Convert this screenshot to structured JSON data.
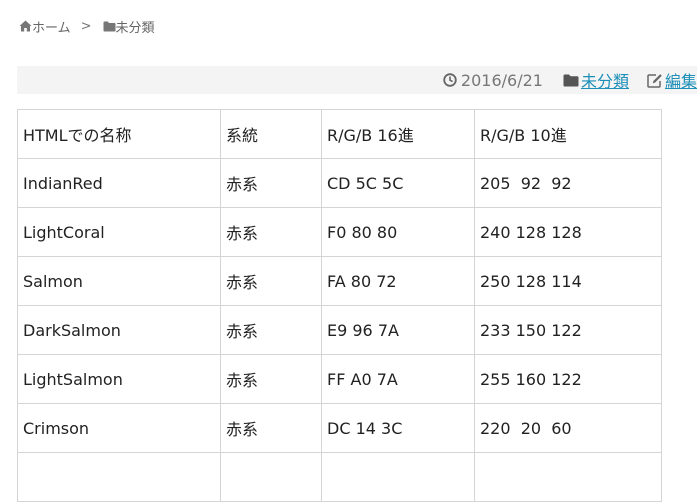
{
  "breadcrumb": {
    "home": "ホーム",
    "separator": ">",
    "category": "未分類"
  },
  "meta": {
    "date": "2016/6/21",
    "category": "未分類",
    "edit": "編集"
  },
  "table": {
    "headers": [
      "HTMLでの名称",
      "系統",
      "R/G/B 16進",
      "R/G/B 10進"
    ],
    "rows": [
      [
        "IndianRed",
        "赤系",
        "CD 5C 5C",
        "205  92  92"
      ],
      [
        "LightCoral",
        "赤系",
        "F0 80 80",
        "240 128 128"
      ],
      [
        "Salmon",
        "赤系",
        "FA 80 72",
        "250 128 114"
      ],
      [
        "DarkSalmon",
        "赤系",
        "E9 96 7A",
        "233 150 122"
      ],
      [
        "LightSalmon",
        "赤系",
        "FF A0 7A",
        "255 160 122"
      ],
      [
        "Crimson",
        "赤系",
        "DC 14 3C",
        "220  20  60"
      ]
    ]
  },
  "colors": {
    "link": "#1d8fb8",
    "meta_bar_bg": "#f4f4f4",
    "table_border": "#d5d5d5"
  },
  "icons": [
    "home-icon",
    "folder-icon",
    "clock-icon",
    "edit-icon"
  ]
}
